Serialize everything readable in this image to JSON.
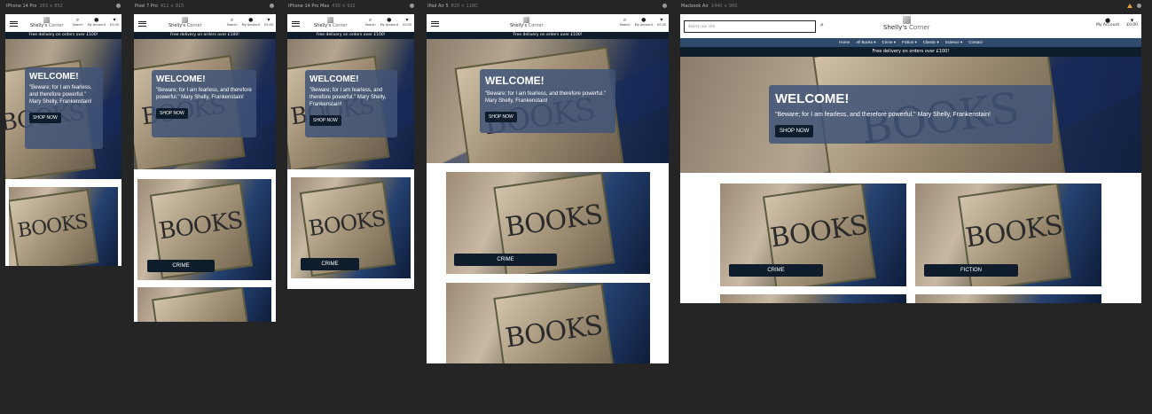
{
  "devices": [
    {
      "name": "iPhone 14 Pro",
      "dims": "393 × 852"
    },
    {
      "name": "Pixel 7 Pro",
      "dims": "412 × 915"
    },
    {
      "name": "iPhone 14 Pro Max",
      "dims": "430 × 932"
    },
    {
      "name": "iPad Air 5",
      "dims": "820 × 1180"
    },
    {
      "name": "Macbook Air",
      "dims": "1440 × 900"
    }
  ],
  "site": {
    "logo_main": "Shelly's",
    "logo_sub": "Corner",
    "search_label": "Search",
    "account_label": "My Account",
    "basket_total": "£0.00",
    "delivery_text": "Free delivery on orders over £100!",
    "search_placeholder": "Search our site",
    "nav": [
      "Home",
      "All Books ▾",
      "Crime ▾",
      "Fiction ▾",
      "Classic ▾",
      "Science ▾",
      "Contact"
    ],
    "hero_title": "WELCOME!",
    "hero_quote": "\"Beware; for I am fearless, and therefore powerful.\" Mary Shelly, Frankenstain!",
    "shop_now": "SHOP NOW",
    "sign_text": "BOOKS",
    "categories": [
      "CRIME",
      "FICTION"
    ]
  },
  "icons": [
    "menu-icon",
    "search-icon",
    "account-icon",
    "basket-icon",
    "settings-icon",
    "warning-icon"
  ]
}
